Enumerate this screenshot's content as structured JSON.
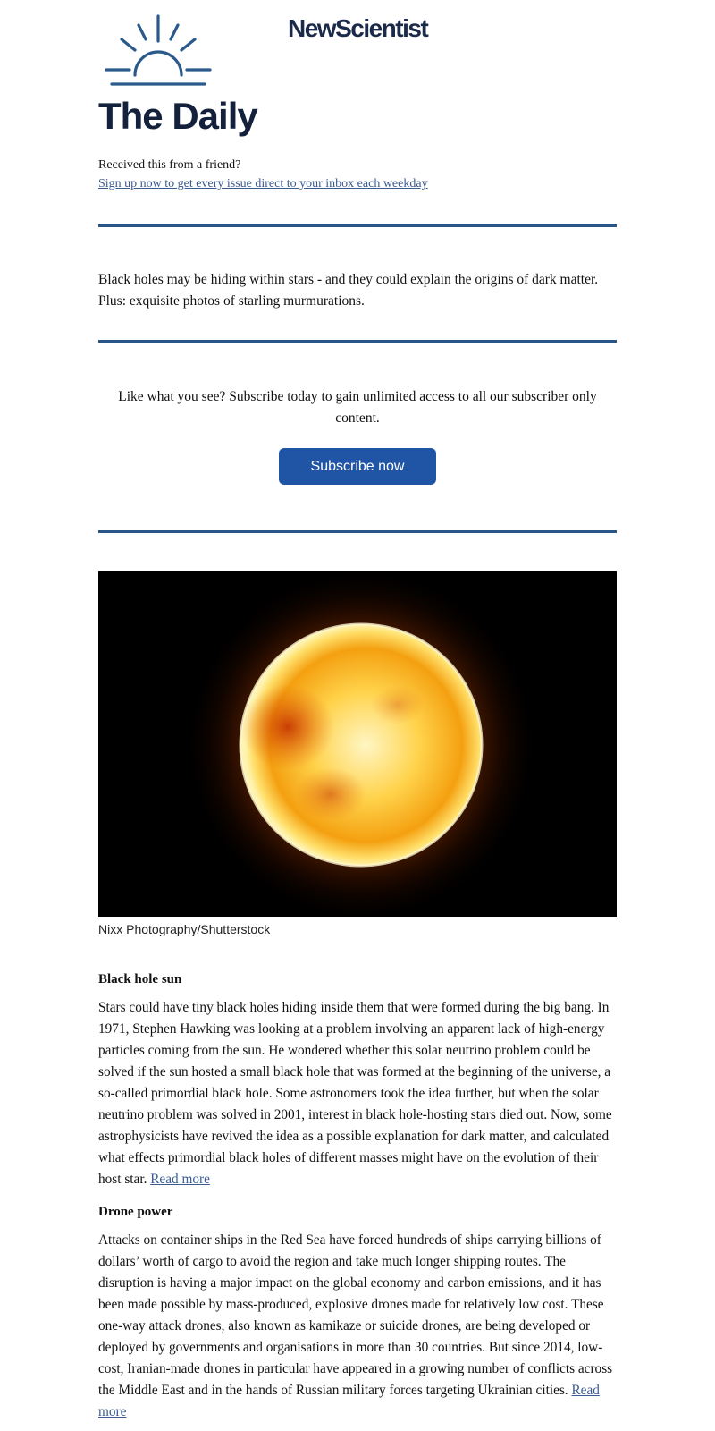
{
  "header": {
    "brand": "NewScientist",
    "title": "The Daily",
    "received_text": "Received this from a friend?",
    "signup_link": "Sign up now to get every issue direct to your inbox each weekday"
  },
  "intro": {
    "text": "Black holes may be hiding within stars - and they could explain the origins of dark matter. Plus: exquisite photos of starling murmurations."
  },
  "promo": {
    "text": "Like what you see? Subscribe today to gain unlimited access to all our subscriber only content.",
    "button_label": "Subscribe now"
  },
  "hero": {
    "caption": "Nixx Photography/Shutterstock"
  },
  "stories": [
    {
      "headline": "Black hole sun",
      "body": "Stars could have tiny black holes hiding inside them that were formed during the big bang. In 1971, Stephen Hawking was looking at a problem involving an apparent lack of high-energy particles coming from the sun. He wondered whether this solar neutrino problem could be solved if the sun hosted a small black hole that was formed at the beginning of the universe, a so-called primordial black hole. Some astronomers took the idea further, but when the solar neutrino problem was solved in 2001, interest in black hole-hosting stars died out. Now, some astrophysicists have revived the idea as a possible explanation for dark matter, and calculated what effects primordial black holes of different masses might have on the evolution of their host star.",
      "link": "Read more"
    },
    {
      "headline": "Drone power",
      "body": "Attacks on container ships in the Red Sea have forced hundreds of ships carrying billions of dollars’ worth of cargo to avoid the region and take much longer shipping routes. The disruption is having a major impact on the global economy and carbon emissions, and it has been made possible by mass-produced, explosive drones made for relatively low cost. These one-way attack drones, also known as kamikaze or suicide drones, are being developed or deployed by governments and organisations in more than 30 countries. But since 2014, low-cost, Iranian-made drones in particular have appeared in a growing number of conflicts across the Middle East and in the hands of Russian military forces targeting Ukrainian cities.",
      "link": "Read more"
    }
  ],
  "colors": {
    "accent": "#2a5687",
    "button": "#2055a6",
    "link": "#3b5b93",
    "title": "#14213d"
  }
}
